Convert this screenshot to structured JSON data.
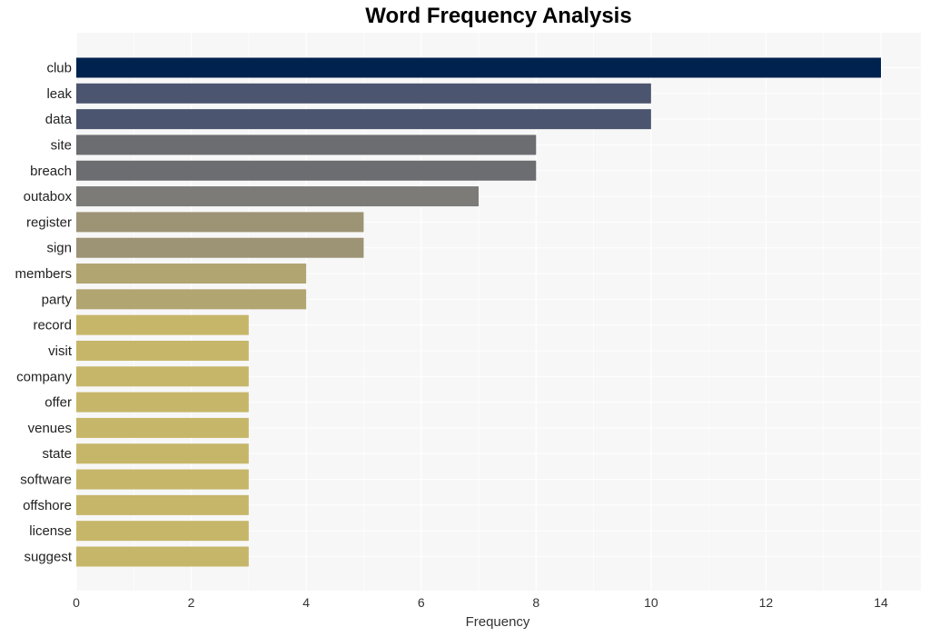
{
  "chart_data": {
    "type": "bar",
    "orientation": "horizontal",
    "title": "Word Frequency Analysis",
    "xlabel": "Frequency",
    "ylabel": "",
    "xlim": [
      0,
      14.7
    ],
    "xticks": [
      0,
      2,
      4,
      6,
      8,
      10,
      12,
      14
    ],
    "grid": true,
    "categories": [
      "club",
      "leak",
      "data",
      "site",
      "breach",
      "outabox",
      "register",
      "sign",
      "members",
      "party",
      "record",
      "visit",
      "company",
      "offer",
      "venues",
      "state",
      "software",
      "offshore",
      "license",
      "suggest"
    ],
    "values": [
      14,
      10,
      10,
      8,
      8,
      7,
      5,
      5,
      4,
      4,
      3,
      3,
      3,
      3,
      3,
      3,
      3,
      3,
      3,
      3
    ],
    "colors": [
      "#00224e",
      "#4c556f",
      "#4c556f",
      "#6c6d71",
      "#6c6d71",
      "#7c7b78",
      "#9d9375",
      "#9d9375",
      "#b1a572",
      "#b1a572",
      "#c6b66a",
      "#c6b66a",
      "#c6b66a",
      "#c6b66a",
      "#c6b66a",
      "#c6b66a",
      "#c6b66a",
      "#c6b66a",
      "#c6b66a",
      "#c6b66a"
    ],
    "background": "#f7f7f7"
  }
}
